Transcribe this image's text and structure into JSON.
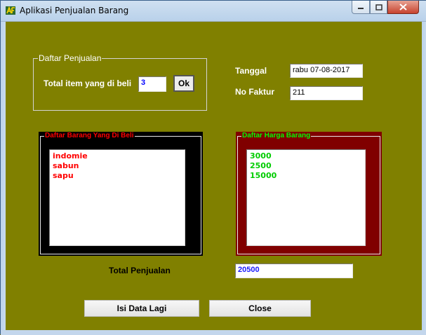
{
  "window": {
    "title": "Aplikasi Penjualan Barang"
  },
  "group_penjualan": {
    "legend": "Daftar Penjualan",
    "total_item_label": "Total item yang di beli",
    "total_item_value": "3",
    "ok_label": "Ok"
  },
  "tanggal": {
    "label": "Tanggal",
    "value": "rabu 07-08-2017"
  },
  "faktur": {
    "label": "No Faktur",
    "value": "211"
  },
  "barang_panel": {
    "legend": "Daftar Barang Yang Di Beli",
    "items": [
      "indomie",
      "sabun",
      "sapu"
    ]
  },
  "harga_panel": {
    "legend": "Daftar Harga Barang",
    "items": [
      "3000",
      "2500",
      "15000"
    ]
  },
  "total": {
    "label": "Total Penjualan",
    "value": "20500"
  },
  "buttons": {
    "isi_label": "Isi Data Lagi",
    "close_label": "Close"
  },
  "colors": {
    "form_bg": "#808000",
    "barang_panel_bg": "#000000",
    "harga_panel_bg": "#800000",
    "barang_text": "#ff0000",
    "harga_text": "#00ff00",
    "value_text": "#0000ff"
  }
}
